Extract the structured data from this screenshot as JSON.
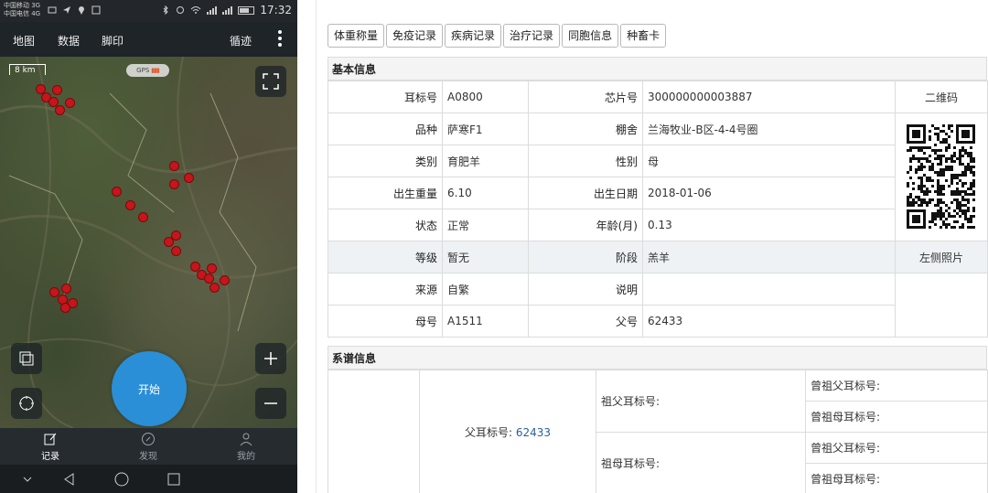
{
  "phone": {
    "status_bar": {
      "carrier_1": "中国移动 3G",
      "carrier_2": "中国电信 4G",
      "time": "17:32"
    },
    "app_bar": {
      "tabs": [
        "地图",
        "数据",
        "脚印"
      ],
      "track_label": "循迹"
    },
    "map": {
      "scale_label": "8 km",
      "gps_label": "GPS"
    },
    "start_button": "开始",
    "bottom_nav": [
      {
        "label": "记录",
        "icon": "edit-icon",
        "active": true
      },
      {
        "label": "发现",
        "icon": "compass-icon",
        "active": false
      },
      {
        "label": "我的",
        "icon": "user-icon",
        "active": false
      }
    ]
  },
  "web": {
    "tabs": [
      "体重称量",
      "免疫记录",
      "疾病记录",
      "治疗记录",
      "同胞信息",
      "种畜卡"
    ],
    "basic_info": {
      "title": "基本信息",
      "rows": [
        {
          "l1": "耳标号",
          "v1": "A0800",
          "l2": "芯片号",
          "v2": "300000000003887"
        },
        {
          "l1": "品种",
          "v1": "萨寒F1",
          "l2": "棚舍",
          "v2": "兰海牧业-B区-4-4号圈"
        },
        {
          "l1": "类别",
          "v1": "育肥羊",
          "l2": "性别",
          "v2": "母"
        },
        {
          "l1": "出生重量",
          "v1": "6.10",
          "l2": "出生日期",
          "v2": "2018-01-06"
        },
        {
          "l1": "状态",
          "v1": "正常",
          "l2": "年龄(月)",
          "v2": "0.13"
        },
        {
          "l1": "等级",
          "v1": "暂无",
          "l2": "阶段",
          "v2": "羔羊"
        },
        {
          "l1": "来源",
          "v1": "自繁",
          "l2": "说明",
          "v2": ""
        },
        {
          "l1": "母号",
          "v1": "A1511",
          "l2": "父号",
          "v2": "62433"
        }
      ],
      "qr_label": "二维码",
      "photo_label": "左侧照片"
    },
    "pedigree": {
      "title": "系谱信息",
      "father_label": "父耳标号:",
      "father_value": "62433",
      "grandfather_label": "祖父耳标号:",
      "grandmother_label": "祖母耳标号:",
      "ggf_label": "曾祖父耳标号:",
      "ggm_label": "曾祖母耳标号:"
    }
  },
  "colors": {
    "pin": "#c4161c",
    "start_button": "#2a8fd6",
    "link": "#2a5f9e",
    "highlight_row": "#eef2f5"
  }
}
